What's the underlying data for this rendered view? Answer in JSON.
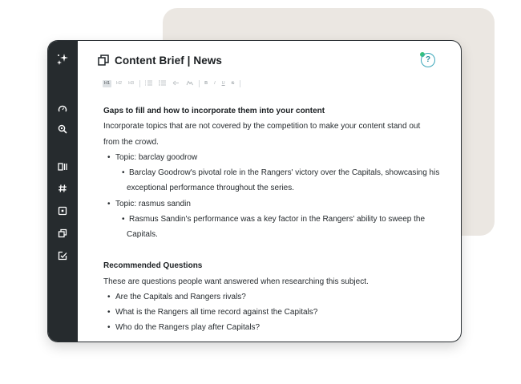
{
  "app": {
    "title": "Content Brief | News",
    "help_label": "?"
  },
  "sidebar": {
    "items": [
      {
        "icon": "sparkles-icon"
      },
      {
        "icon": "gauge-icon"
      },
      {
        "icon": "search-icon"
      },
      {
        "icon": "columns-icon"
      },
      {
        "icon": "hash-icon"
      },
      {
        "icon": "square-dot-icon"
      },
      {
        "icon": "copy-icon"
      },
      {
        "icon": "edit-check-icon"
      }
    ]
  },
  "toolbar": {
    "h1": "H1",
    "h2": "H2",
    "h3": "H3",
    "bold": "B",
    "italic": "I",
    "underline": "U",
    "strike": "S"
  },
  "content": {
    "gaps_heading": "Gaps to fill and how to incorporate them into your content",
    "gaps_intro_1": "Incorporate topics that are not covered by the competition to make your content stand out",
    "gaps_intro_2": "from the crowd.",
    "topic1": "Topic: barclay goodrow",
    "topic1_detail_1": "Barclay Goodrow's pivotal role in the Rangers' victory over the Capitals, showcasing his",
    "topic1_detail_2": "exceptional performance throughout the series.",
    "topic2": "Topic: rasmus sandin",
    "topic2_detail_1": "Rasmus Sandin's performance was a key factor in the Rangers' ability to sweep the",
    "topic2_detail_2": "Capitals.",
    "questions_heading": "Recommended Questions",
    "questions_intro": "These are questions people want answered when researching this subject.",
    "questions": [
      "Are the Capitals and Rangers rivals?",
      "What is the Rangers all time record against the Capitals?",
      "Who do the Rangers play after Capitals?"
    ]
  },
  "colors": {
    "sidebar_bg": "#262b2e",
    "backdrop": "#ebe7e2",
    "help_accent": "#3aa6b9",
    "notification_dot": "#35c27a"
  }
}
